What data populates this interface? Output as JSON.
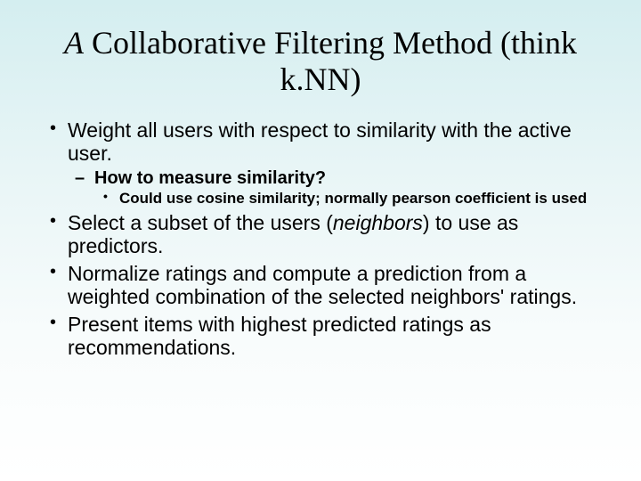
{
  "title": {
    "prefix_italic": "A",
    "rest": " Collaborative Filtering Method (think k.NN)"
  },
  "bullets": {
    "b1": "Weight all users with respect to similarity with the active user.",
    "b1_sub": "How to measure similarity?",
    "b1_sub_sub": "Could use cosine similarity; normally pearson coefficient is used",
    "b2_pre": "Select a subset of the users (",
    "b2_em": "neighbors",
    "b2_post": ") to use as predictors.",
    "b3": "Normalize ratings and compute a prediction from a weighted combination of the selected neighbors' ratings.",
    "b4": "Present items with highest predicted ratings as recommendations."
  }
}
